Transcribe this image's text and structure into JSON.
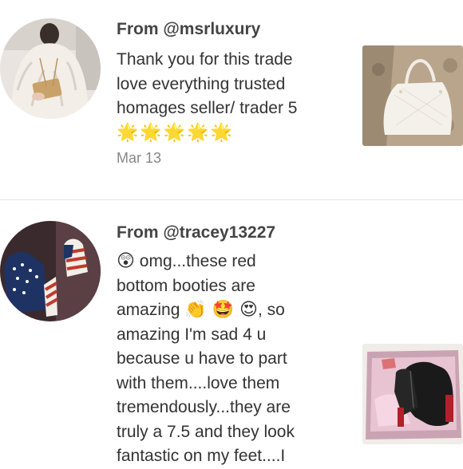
{
  "reviews": [
    {
      "from": "From @msrluxury",
      "lines": [
        "Thank you for this trade",
        "love everything trusted",
        "homages seller/ trader 5"
      ],
      "stars": "🌟🌟🌟🌟🌟",
      "date": "Mar 13",
      "avatar_icon": "avatar-photo-fur-coat",
      "thumbnail_icon": "white-handbag-photo"
    },
    {
      "from": "From @tracey13227",
      "line1_emoji": "😲",
      "line1_text": " omg...these red",
      "line2": "bottom booties are",
      "line3_text": "amazing ",
      "line3_emoji": "👏 🤩 😍",
      "line3_tail": ", so",
      "line4": "amazing I'm sad 4 u",
      "line5": "because u have to part",
      "line6": "with them....love them",
      "line7": "tremendously...they are",
      "line8": "truly a 7.5 and they look",
      "line9": "fantastic on my feet....I",
      "avatar_icon": "avatar-photo-flag-heels",
      "thumbnail_icon": "black-booties-in-box-photo"
    }
  ],
  "colors": {
    "handle_text": "#444444",
    "body_text": "#333333",
    "date_text": "#888888",
    "divider": "#e6e6e6",
    "star": "#f2b600"
  }
}
